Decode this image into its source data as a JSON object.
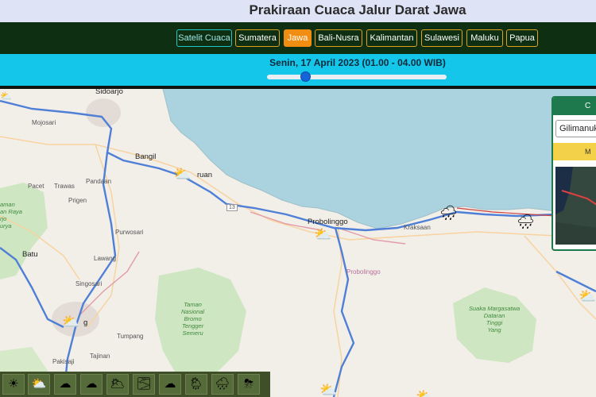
{
  "header": {
    "title": "Prakiraan Cuaca Jalur Darat Jawa"
  },
  "nav": {
    "satelit": "Satelit Cuaca",
    "tabs": [
      "Sumatera",
      "Jawa",
      "Bali-Nusra",
      "Kalimantan",
      "Sulawesi",
      "Maluku",
      "Papua"
    ],
    "active": "Jawa"
  },
  "date_bar": {
    "label": "Senin, 17 April 2023 (01.00 - 04.00 WIB)",
    "slider_position_fraction": 0.22
  },
  "map": {
    "labels": {
      "sidoarjo": "Sidoarjo",
      "mojosari": "Mojosari",
      "bangil": "Bangil",
      "pasuruan": "ruan",
      "probolinggo_city": "Probolinggo",
      "probolinggo_region": "Probolinggo",
      "kraksaan": "Kraksaan",
      "pacet": "Pacet",
      "trawas": "Trawas",
      "pandaan": "Pandaan",
      "prigen": "Prigen",
      "purwosari": "Purwosari",
      "lawang": "Lawang",
      "batu": "Batu",
      "singosari": "Singosari",
      "malang": "g",
      "tumpang": "Tumpang",
      "pakisaji": "Pakisaji",
      "tajinan": "Tajinan",
      "road13": "13",
      "taman_raya": "aman\nan Raya\nrjo\nurya",
      "bromo_park": "Taman\nNasional\nBromo\nTengger\nSemeru",
      "suaka": "Suaka Margasatwa\nDataran\nTinggi\nYang"
    }
  },
  "panel": {
    "header": "C",
    "select_value": "Gilimanuk",
    "button": "M"
  },
  "icons": {
    "map_weather": [
      "partly-cloudy-icon",
      "partly-cloudy-icon",
      "rain-icon",
      "rain-icon",
      "partly-cloudy-icon",
      "partly-cloudy-icon",
      "partly-cloudy-icon",
      "partly-cloudy-icon",
      "cloudy-icon"
    ],
    "legend": [
      "sunny-icon",
      "partly-cloudy-icon",
      "cloudy-icon",
      "cloudy-icon",
      "overcast-icon",
      "haze-icon",
      "fog-icon",
      "light-rain-icon",
      "rain-icon",
      "thunderstorm-icon"
    ]
  },
  "colors": {
    "accent": "#f18e12",
    "nav_bg": "#0f2f12",
    "date_bar": "#14c6ea",
    "sea": "#aad3df",
    "land": "#f2efe9",
    "road": "#4f7fd6"
  }
}
